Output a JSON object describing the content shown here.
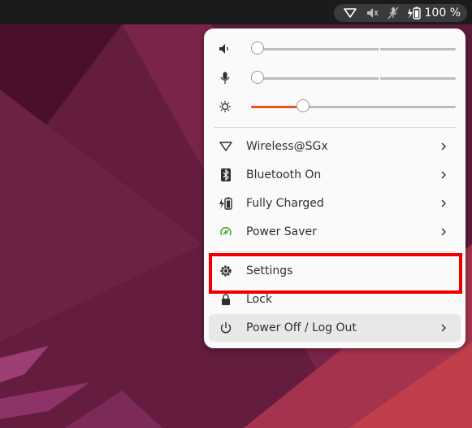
{
  "topbar": {
    "battery_percent": "100 %",
    "icons": [
      "wifi-icon",
      "speaker-muted-icon",
      "mic-muted-icon",
      "battery-charging-icon"
    ]
  },
  "sliders": [
    {
      "name": "volume",
      "icon": "speaker-icon",
      "level": 0.0
    },
    {
      "name": "microphone",
      "icon": "microphone-icon",
      "level": 0.0
    },
    {
      "name": "brightness",
      "icon": "brightness-icon",
      "level": 0.22
    }
  ],
  "menu": {
    "wireless_label": "Wireless@SGx",
    "bluetooth_label": "Bluetooth On",
    "battery_label": "Fully Charged",
    "power_mode_label": "Power Saver",
    "settings_label": "Settings",
    "lock_label": "Lock",
    "power_label": "Power Off / Log Out"
  },
  "colors": {
    "accent": "#e95420",
    "highlight": "#ee0000",
    "power_saver_icon": "#4aa531"
  }
}
